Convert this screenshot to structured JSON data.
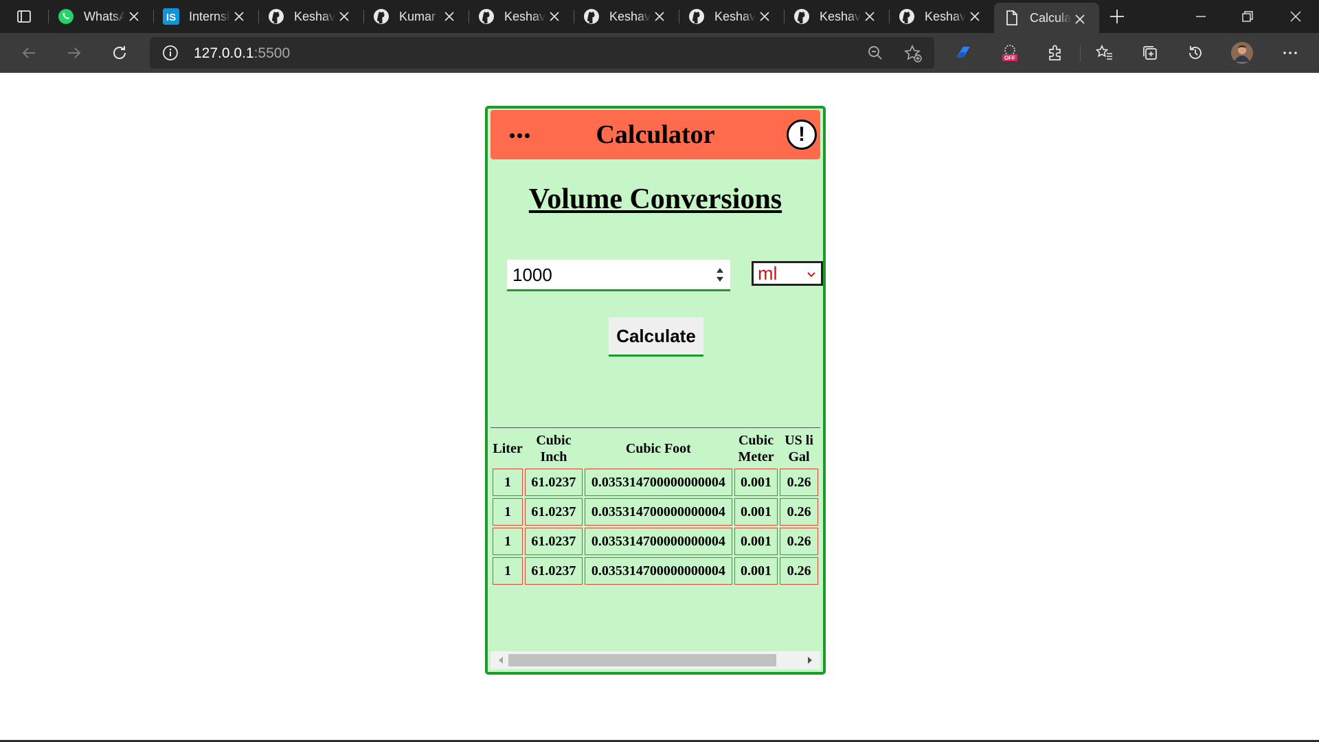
{
  "browser": {
    "tabs": [
      {
        "title": "WhatsApp",
        "icon": "whatsapp-icon",
        "active": false
      },
      {
        "title": "Internshala",
        "icon": "internshala-icon",
        "active": false
      },
      {
        "title": "Keshav",
        "icon": "github-icon",
        "active": false
      },
      {
        "title": "Kumar",
        "icon": "github-icon",
        "active": false
      },
      {
        "title": "Keshav",
        "icon": "github-icon",
        "active": false
      },
      {
        "title": "Keshav",
        "icon": "github-icon",
        "active": false
      },
      {
        "title": "Keshav",
        "icon": "github-icon",
        "active": false
      },
      {
        "title": "Keshav",
        "icon": "github-icon",
        "active": false
      },
      {
        "title": "Keshav",
        "icon": "github-icon",
        "active": false
      },
      {
        "title": "Calculator",
        "icon": "page-icon",
        "active": true
      }
    ],
    "address": {
      "host": "127.0.0.1",
      "port": ":5500"
    },
    "colors": {
      "tabbar": "#202020",
      "toolbar": "#3b3b3b"
    }
  },
  "app": {
    "header": {
      "menu_icon": "more-dots-icon",
      "title": "Calculator",
      "info_label": "!"
    },
    "heading": "Volume Conversions",
    "input": {
      "value": "1000"
    },
    "unit_select": {
      "selected": "ml"
    },
    "calculate_label": "Calculate",
    "table": {
      "headers": [
        "Liter",
        "Cubic Inch",
        "Cubic Foot",
        "Cubic Meter",
        "US li Gal"
      ],
      "rows": [
        [
          "1",
          "61.0237",
          "0.035314700000000004",
          "0.001",
          "0.26"
        ],
        [
          "1",
          "61.0237",
          "0.035314700000000004",
          "0.001",
          "0.26"
        ],
        [
          "1",
          "61.0237",
          "0.035314700000000004",
          "0.001",
          "0.26"
        ],
        [
          "1",
          "61.0237",
          "0.035314700000000004",
          "0.001",
          "0.26"
        ]
      ]
    },
    "colors": {
      "header": "#ff6b4d",
      "panel": "#c6f6c7",
      "border": "#1c9a2a",
      "cell_border": "#d94a3a",
      "select_text": "#d0121b"
    }
  }
}
